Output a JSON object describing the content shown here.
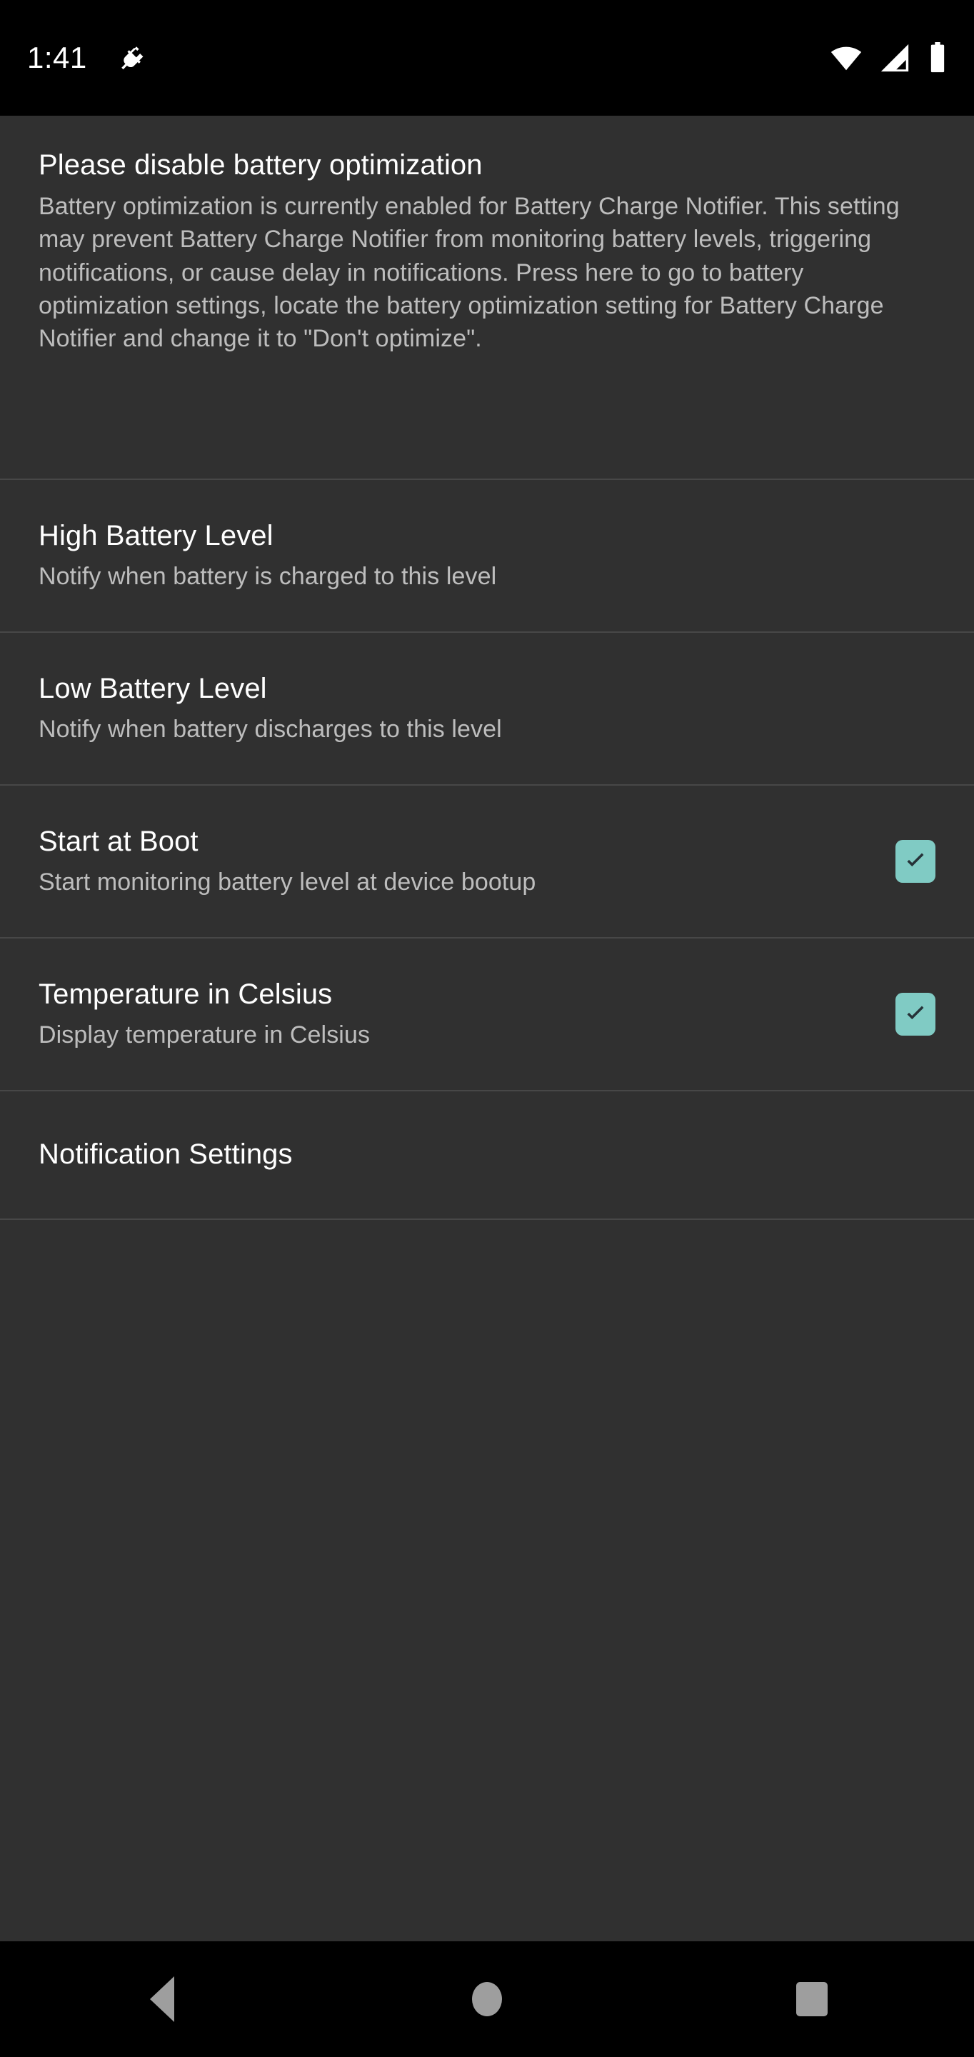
{
  "status_bar": {
    "time": "1:41",
    "icons": [
      "power-plug-icon",
      "wifi-icon",
      "cellular-signal-icon",
      "battery-icon"
    ]
  },
  "colors": {
    "background": "#303030",
    "status_bar": "#000000",
    "nav_bar": "#000000",
    "divider": "#474747",
    "title_text": "#ffffff",
    "summary_text": "#bdbdbd",
    "checkbox_accent": "#80cbc4",
    "checkmark": "#263238",
    "nav_icon": "#9e9e9e"
  },
  "preferences": [
    {
      "id": "battery-optimization",
      "title": "Please disable battery optimization",
      "summary": "Battery optimization is currently enabled for Battery Charge Notifier. This setting may prevent Battery Charge Notifier from monitoring battery levels, triggering notifications, or cause delay in notifications. Press here to go to battery optimization settings, locate the battery optimization setting for Battery Charge Notifier and change it to \"Don't optimize\".",
      "widget": "none"
    },
    {
      "id": "high-battery-level",
      "title": "High Battery Level",
      "summary": "Notify when battery is charged to this level",
      "widget": "none"
    },
    {
      "id": "low-battery-level",
      "title": "Low Battery Level",
      "summary": "Notify when battery discharges to this level",
      "widget": "none"
    },
    {
      "id": "start-at-boot",
      "title": "Start at Boot",
      "summary": "Start monitoring battery level at device bootup",
      "widget": "checkbox",
      "checked": true
    },
    {
      "id": "temperature-in-celsius",
      "title": "Temperature in Celsius",
      "summary": "Display temperature in Celsius",
      "widget": "checkbox",
      "checked": true
    },
    {
      "id": "notification-settings",
      "title": "Notification Settings",
      "summary": "",
      "widget": "none"
    }
  ],
  "nav_bar": {
    "back_label": "back-icon",
    "home_label": "home-icon",
    "recents_label": "recents-icon"
  }
}
